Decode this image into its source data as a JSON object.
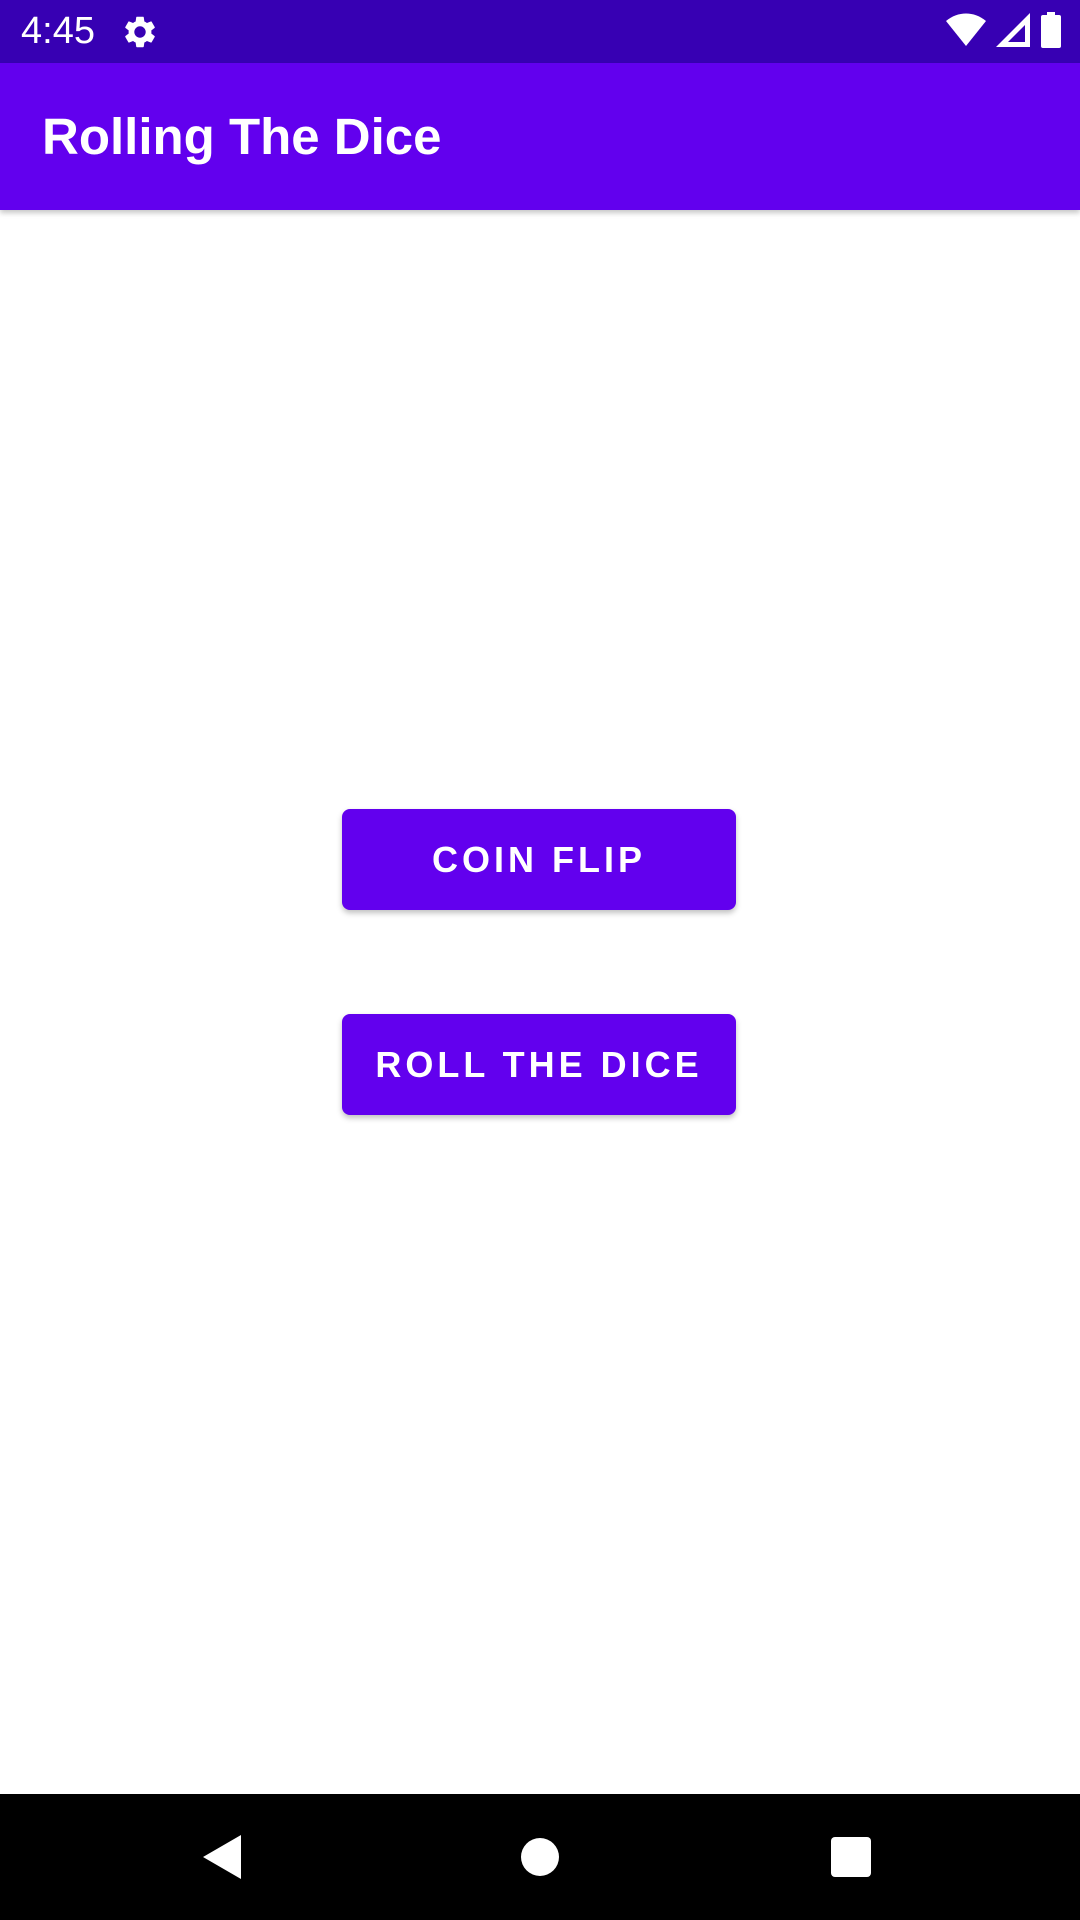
{
  "status_bar": {
    "time": "4:45",
    "icons": [
      "gear-icon",
      "wifi-icon",
      "cell-signal-icon",
      "battery-icon"
    ],
    "background": "#3700b3"
  },
  "app_bar": {
    "title": "Rolling The Dice",
    "background": "#6200ee"
  },
  "main": {
    "buttons": [
      {
        "label": "COIN FLIP"
      },
      {
        "label": "ROLL THE DICE"
      }
    ],
    "button_color": "#6200ee"
  },
  "nav_bar": {
    "icons": [
      "back-icon",
      "home-icon",
      "recents-icon"
    ]
  }
}
